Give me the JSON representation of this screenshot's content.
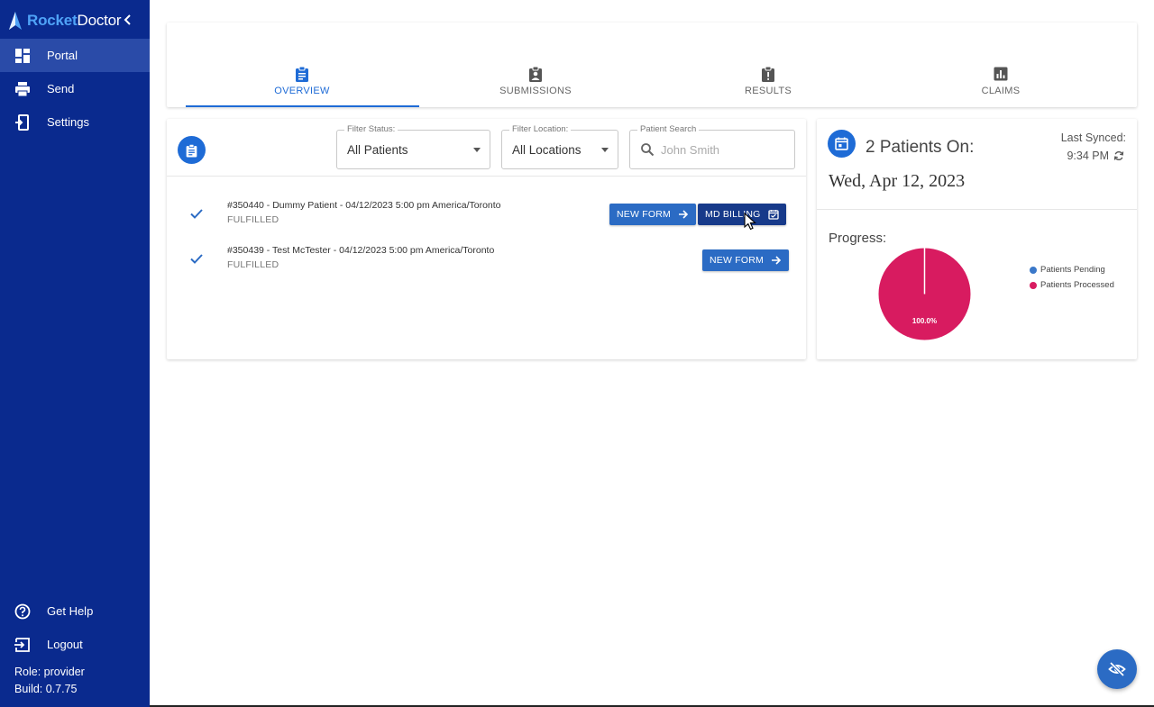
{
  "app": {
    "brand_part1": "Rocket",
    "brand_part2": "Doctor"
  },
  "sidebar": {
    "items": [
      {
        "label": "Portal",
        "icon": "dashboard-icon",
        "active": true
      },
      {
        "label": "Send",
        "icon": "printer-icon",
        "active": false
      },
      {
        "label": "Settings",
        "icon": "settings-icon",
        "active": false
      }
    ],
    "bottom_items": [
      {
        "label": "Get Help",
        "icon": "help-circle-icon"
      },
      {
        "label": "Logout",
        "icon": "logout-icon"
      }
    ],
    "role": "Role: provider",
    "build": "Build: 0.7.75"
  },
  "tabs": [
    {
      "label": "OVERVIEW",
      "icon": "clipboard-icon",
      "active": true
    },
    {
      "label": "SUBMISSIONS",
      "icon": "assignment-ind-icon",
      "active": false
    },
    {
      "label": "RESULTS",
      "icon": "report-icon",
      "active": false
    },
    {
      "label": "CLAIMS",
      "icon": "bar-chart-icon",
      "active": false
    }
  ],
  "filters": {
    "status": {
      "label": "Filter Status:",
      "value": "All Patients"
    },
    "location": {
      "label": "Filter Location:",
      "value": "All Locations"
    },
    "search": {
      "label": "Patient Search",
      "placeholder": "John Smith"
    }
  },
  "patients": [
    {
      "title": "#350440 - Dummy Patient - 04/12/2023 5:00 pm America/Toronto",
      "status": "FULFILLED",
      "new_form_label": "NEW FORM",
      "billing_label": "MD BILLING"
    },
    {
      "title": "#350439 - Test McTester - 04/12/2023 5:00 pm America/Toronto",
      "status": "FULFILLED",
      "new_form_label": "NEW FORM"
    }
  ],
  "summary": {
    "heading": "2 Patients On:",
    "last_synced_label": "Last Synced:",
    "last_synced_time": "9:34 PM",
    "date": "Wed, Apr 12, 2023",
    "progress_label": "Progress:"
  },
  "chart_data": {
    "type": "pie",
    "series": [
      {
        "name": "Patients Pending",
        "value": 0,
        "color": "#3a78c9"
      },
      {
        "name": "Patients Processed",
        "value": 100,
        "color": "#d81b60"
      }
    ],
    "slice_labels": [
      "100.0%"
    ],
    "legend": "right"
  },
  "colors": {
    "sidebar": "#0a2a8e",
    "accent": "#1e6bd6",
    "pie_processed": "#d81b60"
  }
}
